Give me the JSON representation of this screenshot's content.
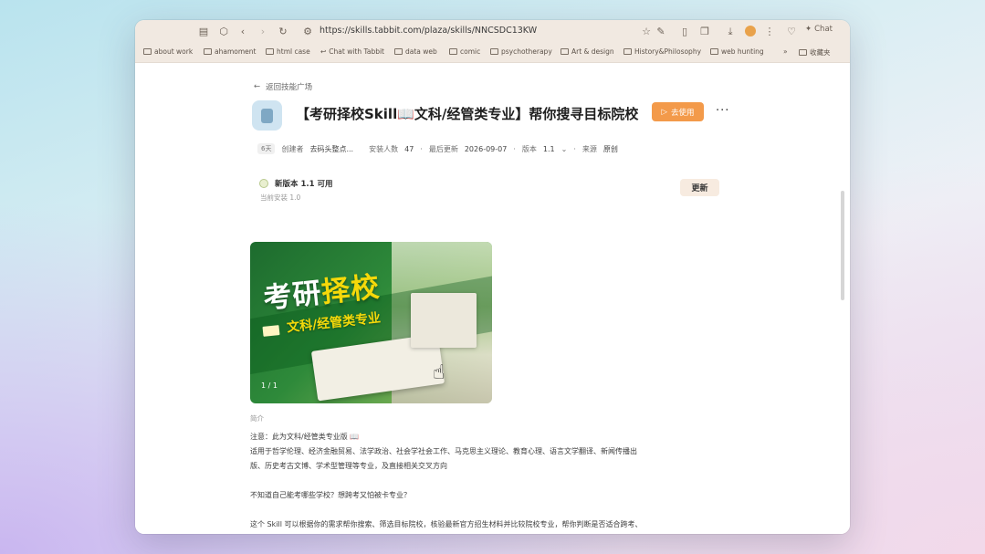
{
  "browser": {
    "url": "https://skills.tabbit.com/plaza/skills/NNCSDC13KW",
    "chat_label": "Chat"
  },
  "bookmarks": [
    {
      "label": "about work"
    },
    {
      "label": "ahamoment"
    },
    {
      "label": "html case"
    },
    {
      "label": "Chat with Tabbit"
    },
    {
      "label": "data web"
    },
    {
      "label": "comic"
    },
    {
      "label": "psychotherapy"
    },
    {
      "label": "Art & design"
    },
    {
      "label": "History&Philosophy"
    },
    {
      "label": "web hunting"
    },
    {
      "label": "收藏夹"
    }
  ],
  "page": {
    "back_label": "返回技能广场",
    "title": "【考研择校Skill📖文科/经管类专业】帮你搜寻目标院校",
    "use_button": "去使用",
    "more_label": "···",
    "meta": {
      "tag": "6天",
      "creator_label": "创建者",
      "creator": "去码头整点...",
      "installs_label": "安装人数",
      "installs": "47",
      "updated_label": "最后更新",
      "updated": "2026-09-07",
      "version_label": "版本",
      "version": "1.1",
      "source_label": "来源",
      "source": "原创"
    },
    "update_card": {
      "title": "新版本 1.1 可用",
      "subtitle": "当前安装 1.0",
      "button": "更新"
    },
    "cover": {
      "title_part1": "考研",
      "title_part2": "择校",
      "subtitle": "文科/经管类专业",
      "pager": "1 / 1"
    },
    "description_label": "简介",
    "description": [
      "注意：此为文科/经管类专业版 📖",
      "适用于哲学伦理、经济金融贸易、法学政治、社会学社会工作、马克思主义理论、教育心理、语言文学翻译、新闻传播出",
      "版、历史考古文博、学术型管理等专业，及直接相关交叉方向",
      "",
      "不知道自己能考哪些学校？想跨考又怕被卡专业？",
      "",
      "这个 Skill 可以根据你的需求帮你搜索、筛选目标院校，核验最新官方招生材料并比较院校专业，帮你判断是否适合跨考、"
    ]
  },
  "colors": {
    "accent": "#f39a4a",
    "cover_green": "#1d6b2e",
    "cover_yellow": "#f5d90a"
  }
}
